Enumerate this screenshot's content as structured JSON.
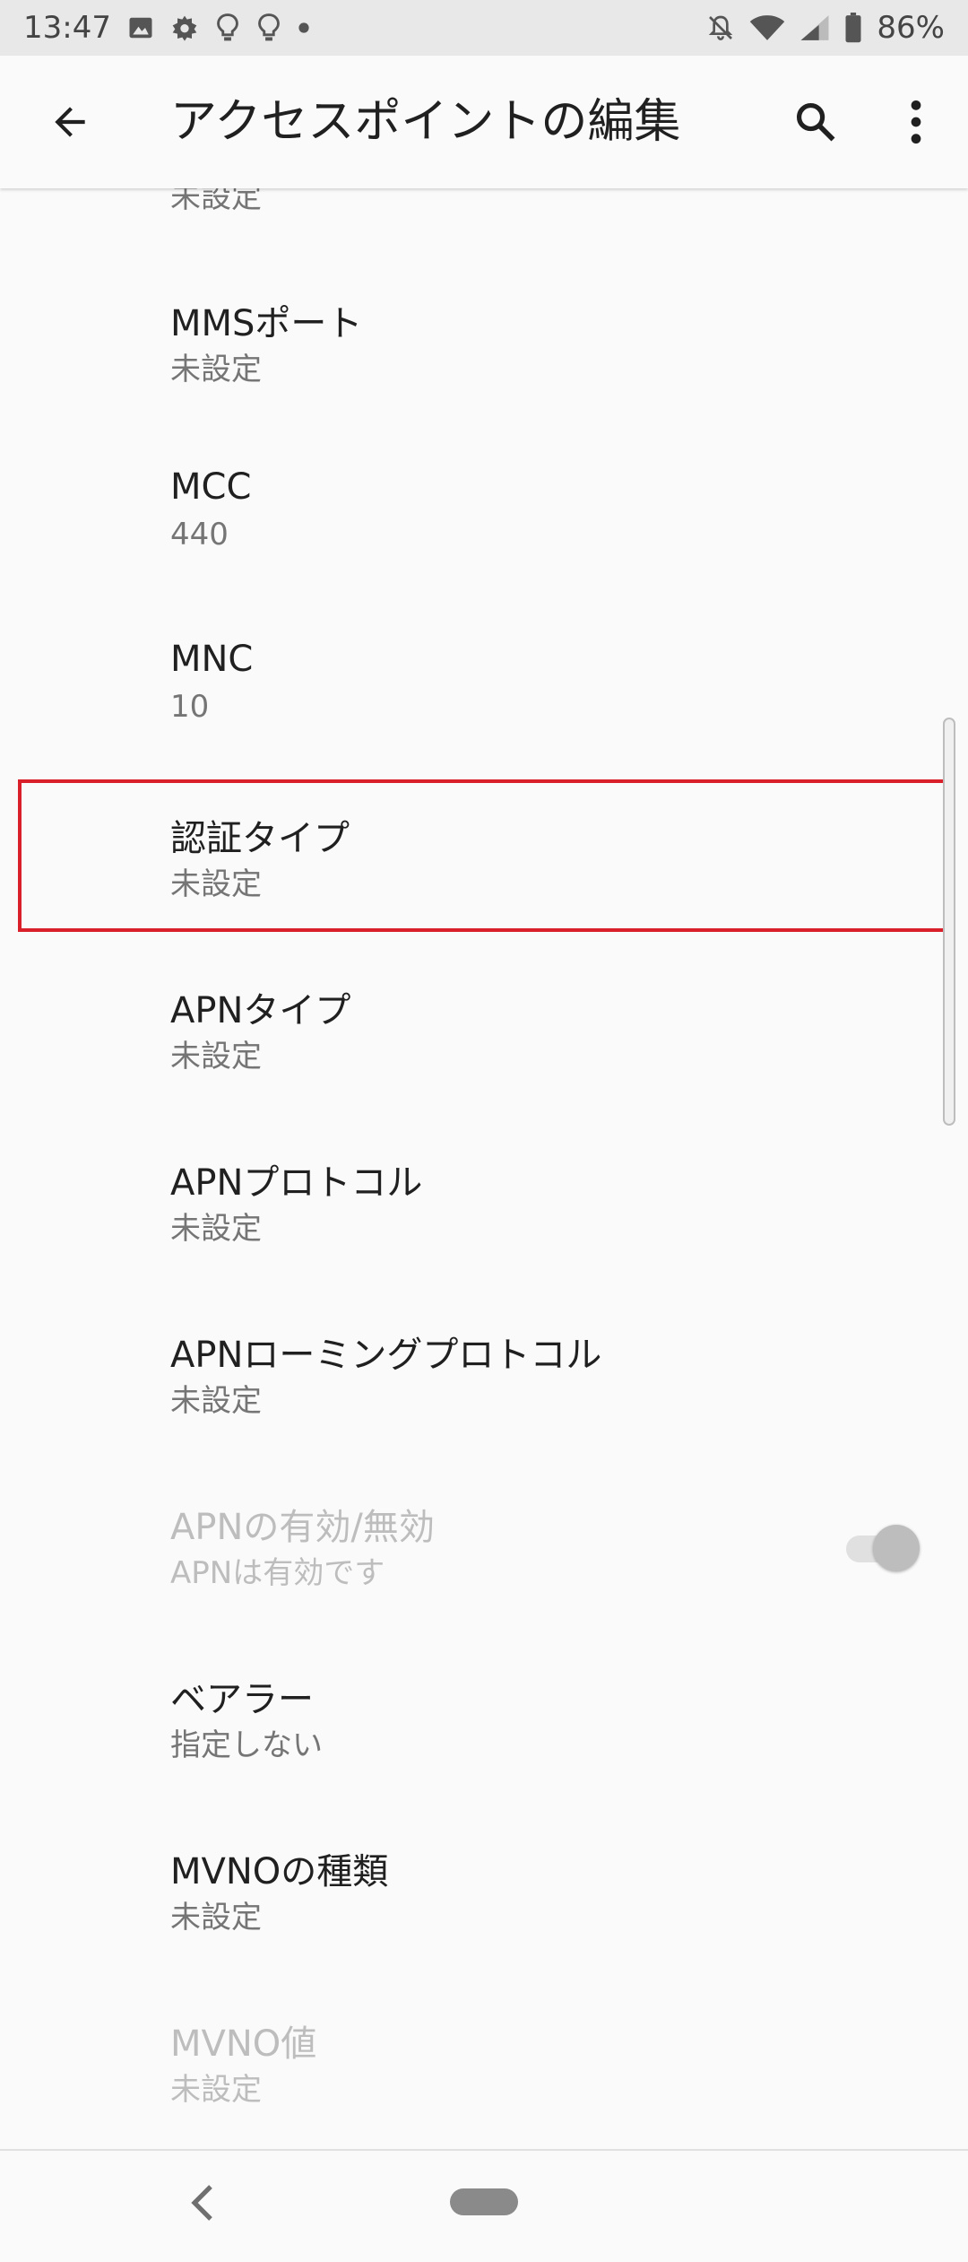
{
  "status_bar": {
    "time": "13:47",
    "battery": "86%",
    "left_icons": [
      "image-icon",
      "gear-icon",
      "lightbulb-icon",
      "lightbulb-icon",
      "dot-icon"
    ],
    "right_icons": [
      "notifications-off-icon",
      "wifi-icon",
      "cell-signal-icon",
      "battery-icon"
    ]
  },
  "app_bar": {
    "title": "アクセスポイントの編集",
    "back_icon": "arrow-back-icon",
    "search_icon": "search-icon",
    "more_icon": "more-vert-icon"
  },
  "partial_top_summary": "未設定",
  "preferences": [
    {
      "title": "MMSポート",
      "summary": "未設定"
    },
    {
      "title": "MCC",
      "summary": "440"
    },
    {
      "title": "MNC",
      "summary": "10"
    },
    {
      "title": "認証タイプ",
      "summary": "未設定"
    },
    {
      "title": "APNタイプ",
      "summary": "未設定"
    },
    {
      "title": "APNプロトコル",
      "summary": "未設定"
    },
    {
      "title": "APNローミングプロトコル",
      "summary": "未設定"
    },
    {
      "title": "APNの有効/無効",
      "summary": "APNは有効です",
      "disabled": true,
      "toggle": true
    },
    {
      "title": "ベアラー",
      "summary": "指定しない"
    },
    {
      "title": "MVNOの種類",
      "summary": "未設定"
    },
    {
      "title": "MVNO値",
      "summary": "未設定",
      "disabled": true
    }
  ],
  "highlight_color": "#d9202a",
  "nav_bar": {
    "back_icon": "nav-back-icon",
    "home_icon": "nav-home-pill-icon"
  }
}
